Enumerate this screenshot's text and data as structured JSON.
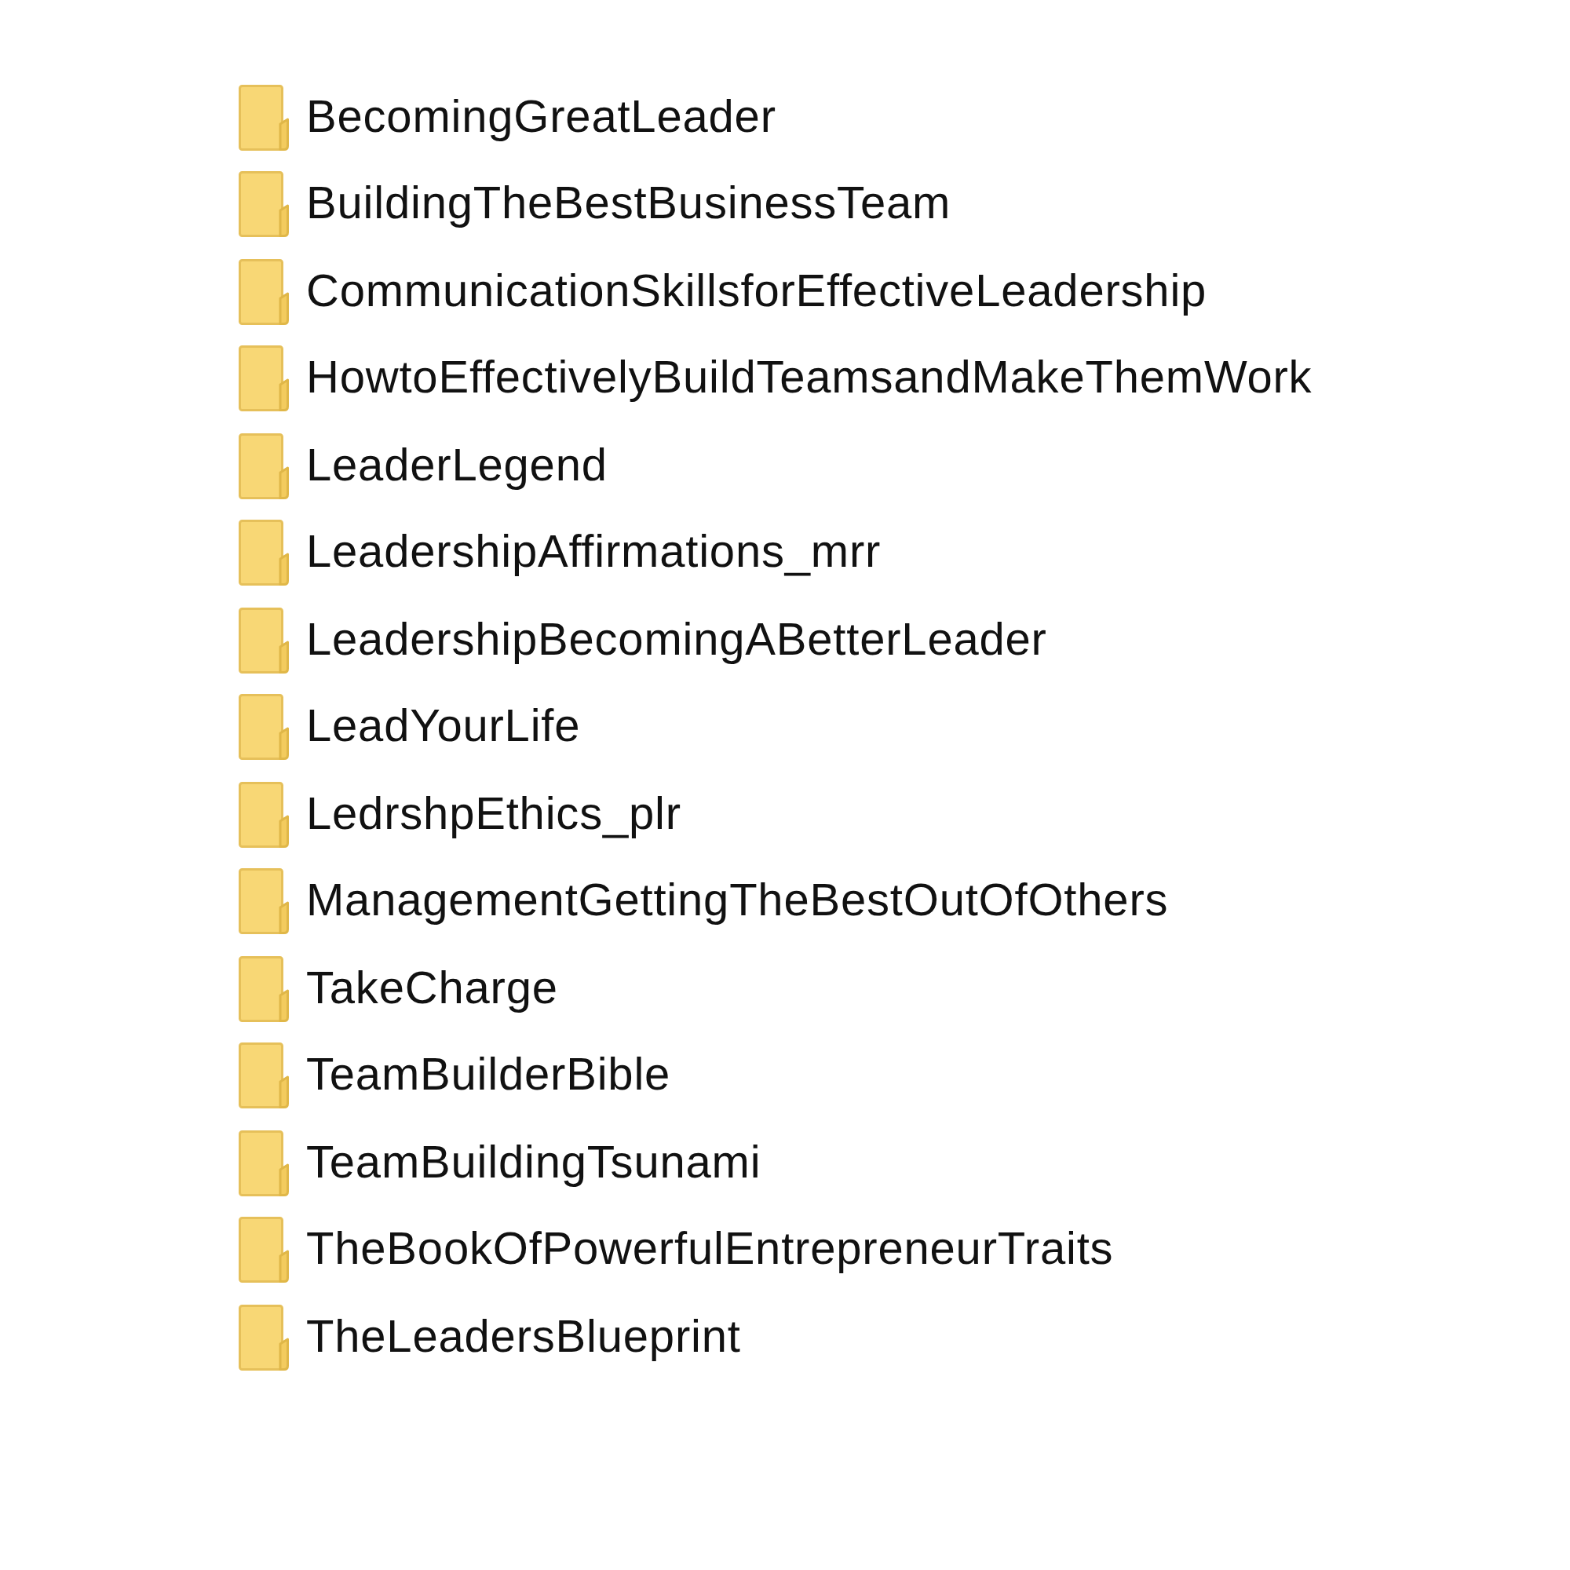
{
  "folders": [
    {
      "name": "BecomingGreatLeader"
    },
    {
      "name": "BuildingTheBestBusinessTeam"
    },
    {
      "name": "CommunicationSkillsforEffectiveLeadership"
    },
    {
      "name": "HowtoEffectivelyBuildTeamsandMakeThemWork"
    },
    {
      "name": "LeaderLegend"
    },
    {
      "name": "LeadershipAffirmations_mrr"
    },
    {
      "name": "LeadershipBecomingABetterLeader"
    },
    {
      "name": "LeadYourLife"
    },
    {
      "name": "LedrshpEthics_plr"
    },
    {
      "name": "ManagementGettingTheBestOutOfOthers"
    },
    {
      "name": "TakeCharge"
    },
    {
      "name": "TeamBuilderBible"
    },
    {
      "name": "TeamBuildingTsunami"
    },
    {
      "name": "TheBookOfPowerfulEntrepreneurTraits"
    },
    {
      "name": "TheLeadersBlueprint"
    }
  ]
}
